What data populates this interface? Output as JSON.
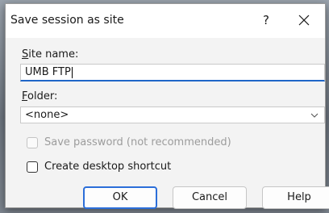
{
  "dialog": {
    "title": "Save session as site",
    "help_glyph": "?",
    "close_icon": "close-icon"
  },
  "fields": {
    "site_name": {
      "label_mnemonic": "S",
      "label_rest": "ite name:",
      "value": "UMB FTP"
    },
    "folder": {
      "label_mnemonic": "F",
      "label_rest": "older:",
      "selected": "<none>"
    }
  },
  "checkboxes": {
    "save_password": {
      "label": "Save password (not recommended)",
      "checked": false,
      "disabled": true
    },
    "desktop_shortcut": {
      "label": "Create desktop shortcut",
      "checked": false,
      "disabled": false
    }
  },
  "buttons": {
    "ok": "OK",
    "cancel": "Cancel",
    "help": "Help"
  },
  "colors": {
    "accent": "#1f66c8",
    "default_button_border": "#2b6ed9"
  }
}
